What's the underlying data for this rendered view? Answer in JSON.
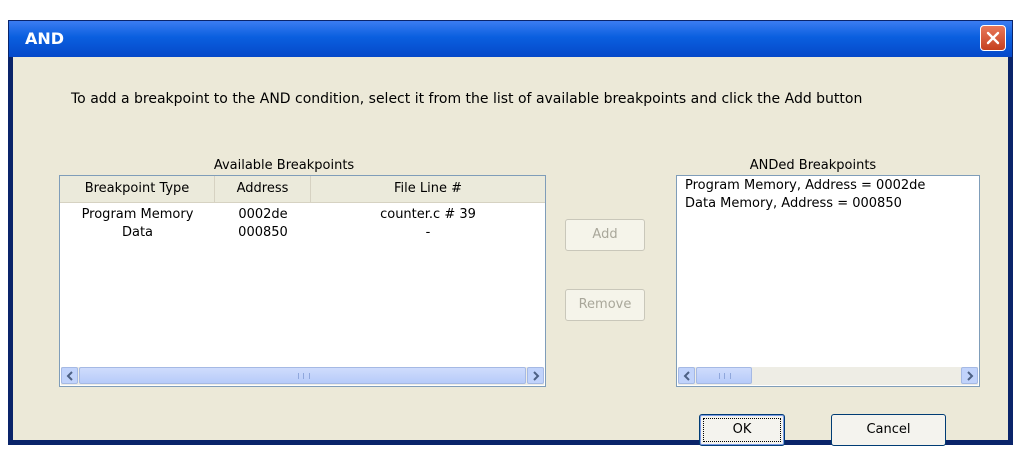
{
  "window": {
    "title": "AND"
  },
  "instruction": "To add a breakpoint to the AND condition, select it from the list of available breakpoints and click the Add button",
  "available": {
    "caption": "Available Breakpoints",
    "columns": [
      "Breakpoint Type",
      "Address",
      "File Line #"
    ],
    "rows": [
      [
        "Program Memory",
        "0002de",
        "counter.c # 39"
      ],
      [
        "Data",
        "000850",
        "-"
      ]
    ]
  },
  "actions": {
    "add_label": "Add",
    "remove_label": "Remove"
  },
  "anded": {
    "caption": "ANDed Breakpoints",
    "items": [
      "Program Memory, Address = 0002de",
      "Data Memory, Address = 000850"
    ]
  },
  "footer": {
    "ok_label": "OK",
    "cancel_label": "Cancel"
  },
  "icons": {
    "close": "close-icon",
    "scroll_left": "arrow-left-icon",
    "scroll_right": "arrow-right-icon"
  }
}
